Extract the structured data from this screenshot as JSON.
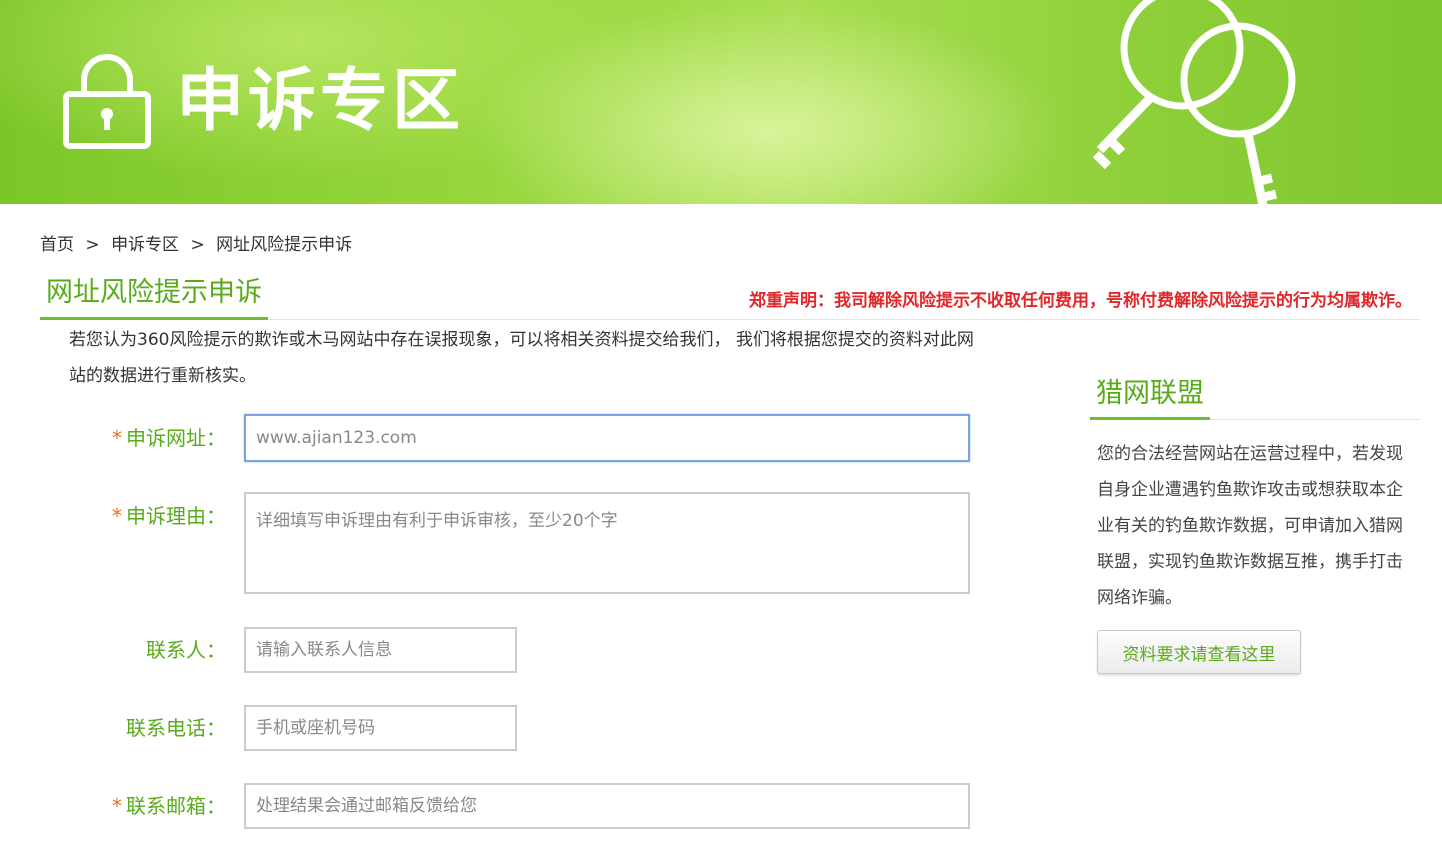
{
  "banner": {
    "title": "申诉专区"
  },
  "breadcrumb": {
    "items": [
      "首页",
      "申诉专区",
      "网址风险提示申诉"
    ],
    "separator": ">"
  },
  "section": {
    "title": "网址风险提示申诉",
    "notice": "郑重声明：我司解除风险提示不收取任何费用，号称付费解除风险提示的行为均属欺诈。",
    "intro": "若您认为360风险提示的欺诈或木马网站中存在误报现象，可以将相关资料提交给我们， 我们将根据您提交的资料对此网站的数据进行重新核实。"
  },
  "form": {
    "required_mark": "*",
    "url": {
      "label": "申诉网址：",
      "value": "www.ajian123.com",
      "placeholder": ""
    },
    "reason": {
      "label": "申诉理由：",
      "value": "",
      "placeholder": "详细填写申诉理由有利于申诉审核，至少20个字"
    },
    "contact": {
      "label": "联系人：",
      "value": "",
      "placeholder": "请输入联系人信息"
    },
    "phone": {
      "label": "联系电话：",
      "value": "",
      "placeholder": "手机或座机号码"
    },
    "email": {
      "label": "联系邮箱：",
      "value": "",
      "placeholder": "处理结果会通过邮箱反馈给您"
    }
  },
  "sidebar": {
    "title": "猎网联盟",
    "description": "您的合法经营网站在运营过程中，若发现自身企业遭遇钓鱼欺诈攻击或想获取本企业有关的钓鱼欺诈数据，可申请加入猎网联盟，实现钓鱼欺诈数据互推，携手打击网络诈骗。",
    "button_label": "资料要求请查看这里"
  },
  "colors": {
    "accent_green": "#5aab1c",
    "notice_red": "#e0282a",
    "required_orange": "#f26b1d"
  },
  "icons": {
    "banner_lock": "padlock-icon",
    "banner_keys": "keys-icon"
  }
}
